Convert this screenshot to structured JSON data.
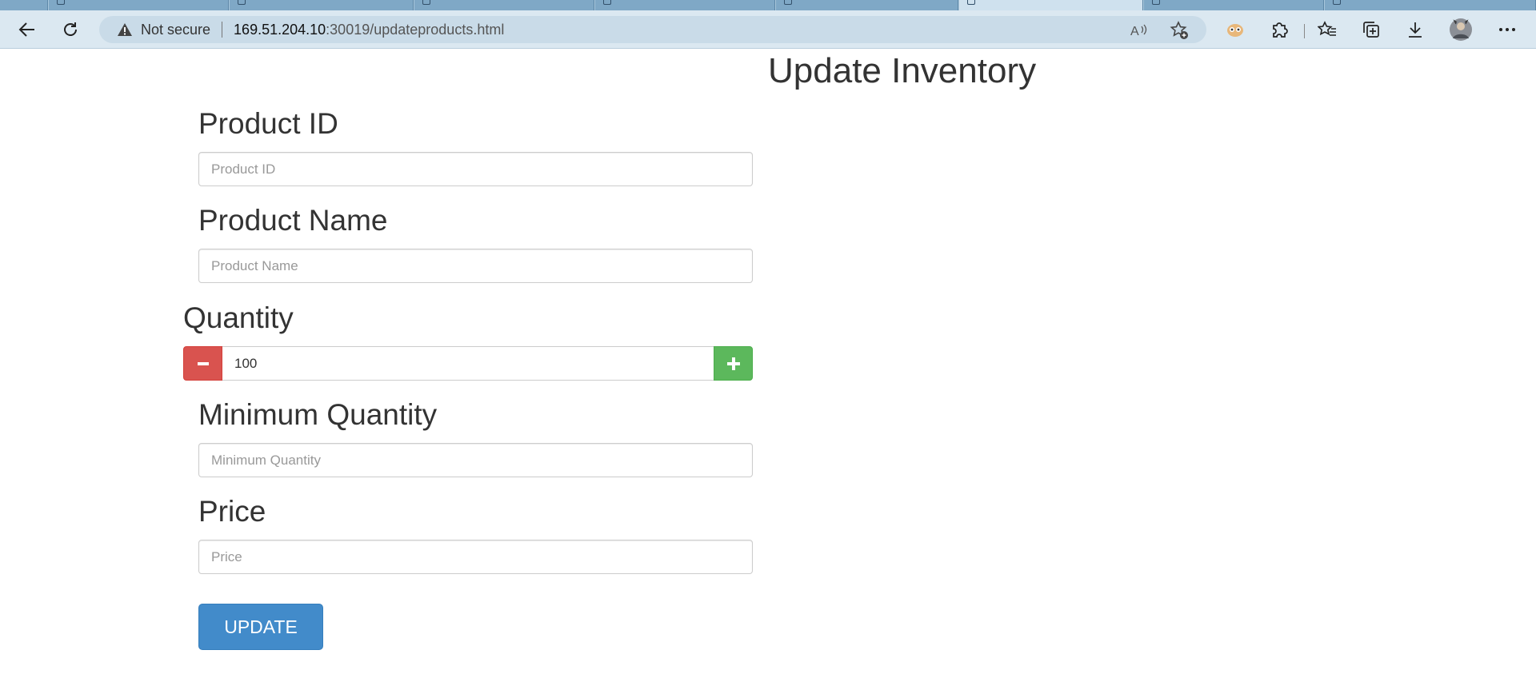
{
  "browser": {
    "address": {
      "security_text": "Not secure",
      "host": "169.51.204.10",
      "path": ":30019/updateproducts.html"
    },
    "icons": {
      "back": "back-arrow-icon",
      "refresh": "refresh-icon",
      "warning": "warning-icon",
      "read_aloud": "read-aloud-icon",
      "add_favorite": "add-favorite-icon",
      "extension_profile": "extension-icon",
      "extensions": "puzzle-icon",
      "favorites": "favorites-icon",
      "collections": "collections-icon",
      "downloads": "download-icon",
      "avatar": "avatar",
      "more": "more-icon"
    }
  },
  "page": {
    "title": "Update Inventory",
    "product_id": {
      "label": "Product ID",
      "placeholder": "Product ID",
      "value": ""
    },
    "product_name": {
      "label": "Product Name",
      "placeholder": "Product Name",
      "value": ""
    },
    "quantity": {
      "label": "Quantity",
      "value": "100"
    },
    "minimum_quantity": {
      "label": "Minimum Quantity",
      "placeholder": "Minimum Quantity",
      "value": ""
    },
    "price": {
      "label": "Price",
      "placeholder": "Price",
      "value": ""
    },
    "submit_label": "UPDATE"
  },
  "colors": {
    "minus_button": "#d9534f",
    "plus_button": "#5cb85c",
    "update_button": "#428bca",
    "chrome_toolbar": "#dbe8f1"
  }
}
